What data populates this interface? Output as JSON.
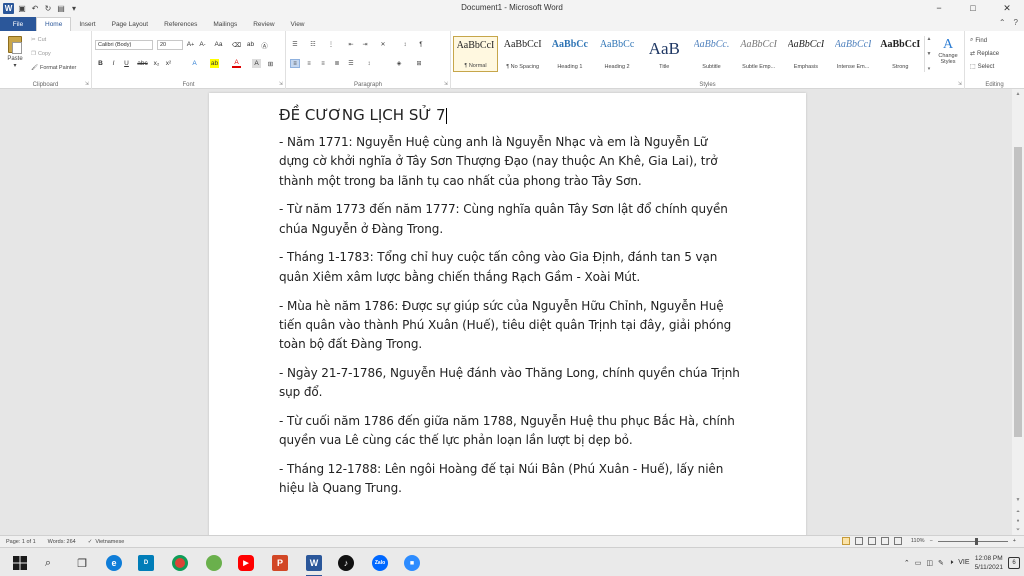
{
  "window": {
    "title": "Document1 - Microsoft Word",
    "minimize": "−",
    "maximize": "□",
    "close": "✕"
  },
  "tabs": [
    {
      "label": "File"
    },
    {
      "label": "Home"
    },
    {
      "label": "Insert"
    },
    {
      "label": "Page Layout"
    },
    {
      "label": "References"
    },
    {
      "label": "Mailings"
    },
    {
      "label": "Review"
    },
    {
      "label": "View"
    }
  ],
  "ribbon": {
    "clipboard": {
      "label": "Clipboard",
      "paste": "Paste",
      "cut": "Cut",
      "copy": "Copy",
      "format_painter": "Format Painter"
    },
    "font": {
      "label": "Font",
      "font_name": "Calibri (Body)",
      "font_size": "20"
    },
    "paragraph": {
      "label": "Paragraph"
    },
    "styles": {
      "label": "Styles",
      "items": [
        {
          "sample": "AaBbCcI",
          "name": "¶ Normal"
        },
        {
          "sample": "AaBbCcI",
          "name": "¶ No Spacing"
        },
        {
          "sample": "AaBbCc",
          "name": "Heading 1"
        },
        {
          "sample": "AaBbCc",
          "name": "Heading 2"
        },
        {
          "sample": "AaB",
          "name": "Title"
        },
        {
          "sample": "AaBbCc.",
          "name": "Subtitle"
        },
        {
          "sample": "AaBbCcI",
          "name": "Subtle Emp..."
        },
        {
          "sample": "AaBbCcI",
          "name": "Emphasis"
        },
        {
          "sample": "AaBbCcI",
          "name": "Intense Em..."
        },
        {
          "sample": "AaBbCcI",
          "name": "Strong"
        }
      ],
      "change_styles": "Change Styles"
    },
    "editing": {
      "label": "Editing",
      "find": "Find",
      "replace": "Replace",
      "select": "Select"
    }
  },
  "document": {
    "title": "ĐỀ CƯƠNG LỊCH SỬ 7",
    "paragraphs": [
      "- Năm 1771: Nguyễn Huệ cùng anh là Nguyễn Nhạc và em là Nguyễn Lữ dựng cờ khởi nghĩa ở Tây Sơn Thượng Đạo (nay thuộc An Khê, Gia Lai), trở thành một trong ba lãnh tụ cao nhất của phong trào Tây Sơn.",
      "- Từ năm 1773 đến năm 1777: Cùng nghĩa quân Tây Sơn lật đổ chính quyền chúa Nguyễn ở Đàng Trong.",
      "- Tháng 1-1783: Tổng chỉ huy cuộc tấn công vào Gia Định, đánh tan 5 vạn quân Xiêm xâm lược bằng chiến thắng Rạch Gầm - Xoài Mút.",
      "- Mùa hè năm 1786: Được sự giúp sức của Nguyễn Hữu Chỉnh, Nguyễn Huệ tiến quân vào thành Phú Xuân (Huế), tiêu diệt quân Trịnh tại đây, giải phóng toàn bộ đất Đàng Trong.",
      "- Ngày 21-7-1786, Nguyễn Huệ đánh vào Thăng Long, chính quyền chúa Trịnh sụp đổ.",
      "- Từ cuối năm 1786 đến giữa năm 1788, Nguyễn Huệ thu phục Bắc Hà, chính quyền vua Lê cùng các thế lực phản loạn lần lượt bị dẹp bỏ.",
      "- Tháng 12-1788: Lên ngôi Hoàng đế tại Núi Bân (Phú Xuân - Huế), lấy niên hiệu là Quang Trung."
    ]
  },
  "statusbar": {
    "page": "Page: 1 of 1",
    "words": "Words: 264",
    "language": "Vietnamese",
    "zoom": "110%",
    "zoom_minus": "−",
    "zoom_plus": "+"
  },
  "taskbar": {
    "language": "VIE",
    "time": "12:08 PM",
    "date": "5/11/2021",
    "notification_count": "6"
  },
  "colors": {
    "accent": "#2b579a",
    "taskbar": "#eaeaea"
  }
}
